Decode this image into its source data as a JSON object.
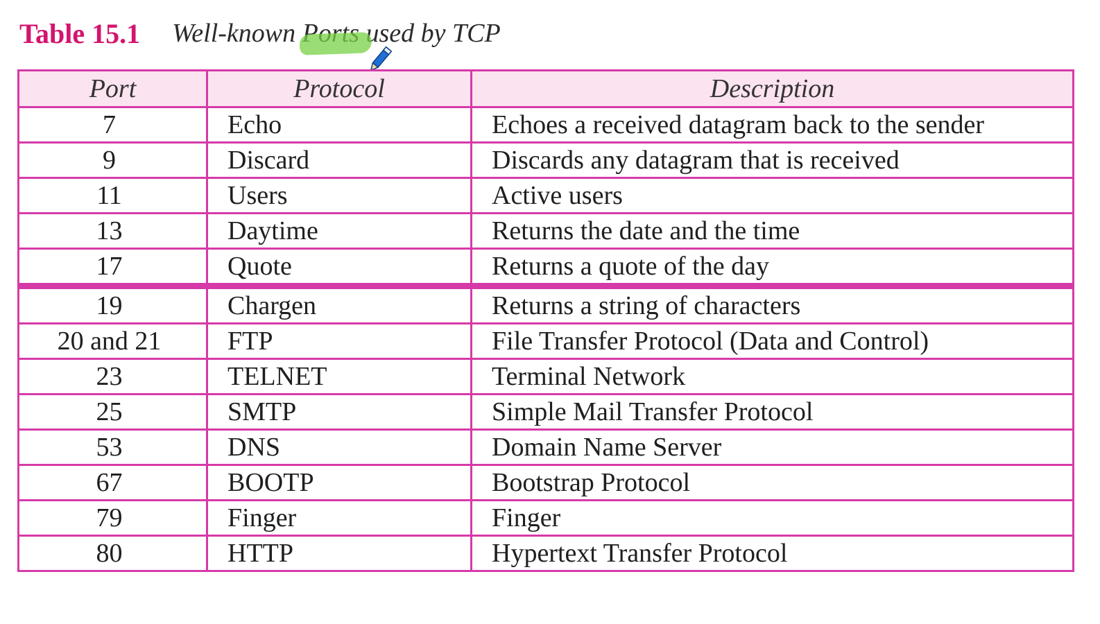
{
  "caption": {
    "number": "Table 15.1",
    "title": "Well-known Ports used by TCP"
  },
  "table": {
    "headers": [
      "Port",
      "Protocol",
      "Description"
    ],
    "rows": [
      {
        "port": "7",
        "protocol": "Echo",
        "description": "Echoes a received datagram back to the sender"
      },
      {
        "port": "9",
        "protocol": "Discard",
        "description": "Discards any datagram that is received"
      },
      {
        "port": "11",
        "protocol": "Users",
        "description": "Active users"
      },
      {
        "port": "13",
        "protocol": "Daytime",
        "description": "Returns the date and the time"
      },
      {
        "port": "17",
        "protocol": "Quote",
        "description": "Returns a quote of the day"
      },
      {
        "port": "19",
        "protocol": "Chargen",
        "description": "Returns a string of characters"
      },
      {
        "port": "20 and 21",
        "protocol": "FTP",
        "description": "File Transfer Protocol (Data and Control)"
      },
      {
        "port": "23",
        "protocol": "TELNET",
        "description": "Terminal Network"
      },
      {
        "port": "25",
        "protocol": "SMTP",
        "description": "Simple Mail Transfer Protocol"
      },
      {
        "port": "53",
        "protocol": "DNS",
        "description": "Domain Name Server"
      },
      {
        "port": "67",
        "protocol": "BOOTP",
        "description": "Bootstrap Protocol"
      },
      {
        "port": "79",
        "protocol": "Finger",
        "description": "Finger"
      },
      {
        "port": "80",
        "protocol": "HTTP",
        "description": "Hypertext Transfer Protocol"
      }
    ]
  },
  "colors": {
    "caption_accent": "#d4146e",
    "table_border": "#d63aa8",
    "header_background": "#fbe3f0",
    "highlighter": "#78d246"
  },
  "icons": {
    "annotation": "highlighter-mark",
    "cursor": "pen-cursor-icon"
  }
}
